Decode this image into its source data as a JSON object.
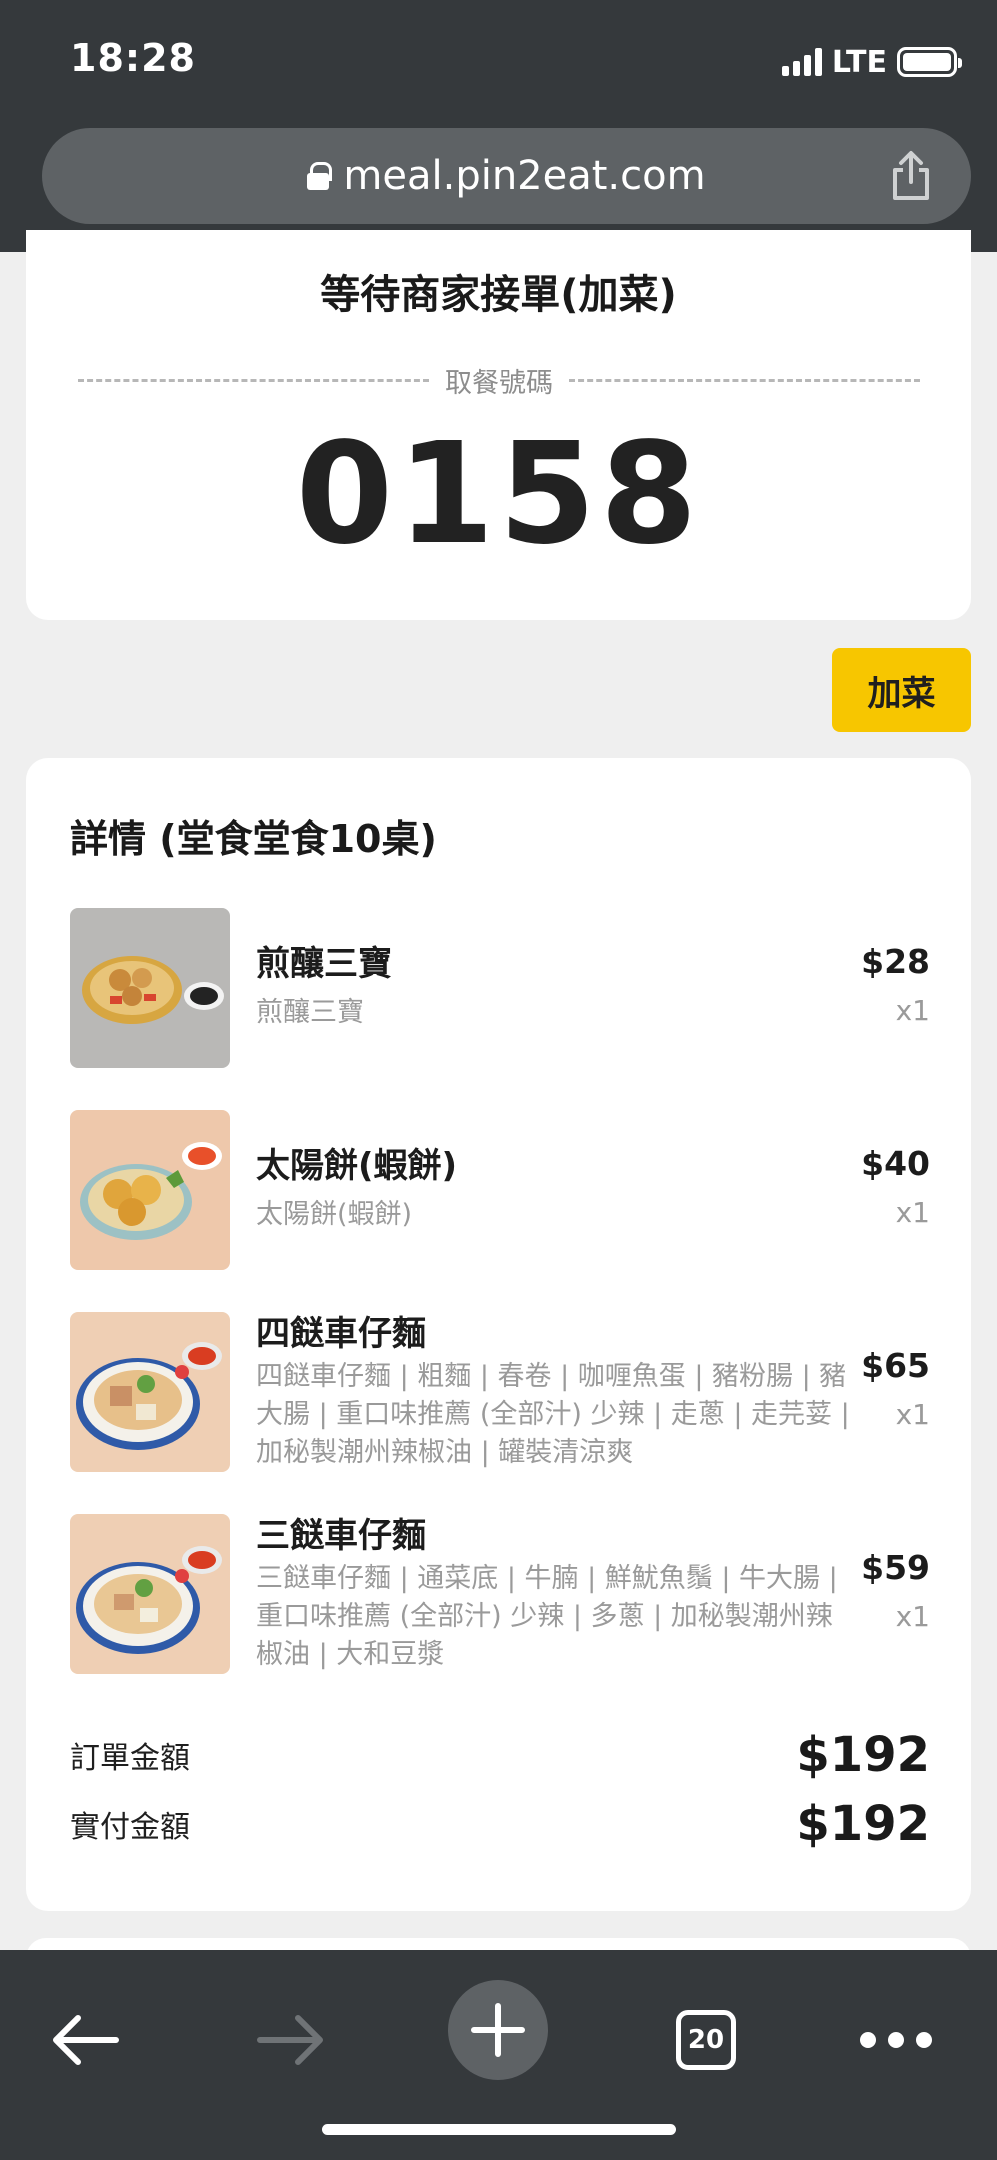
{
  "status_bar": {
    "time": "18:28",
    "network": "LTE"
  },
  "browser": {
    "url": "meal.pin2eat.com",
    "tab_count": "20",
    "icons": {
      "lock": "lock-icon",
      "share": "share-icon",
      "back": "arrow-left-icon",
      "forward": "arrow-right-icon",
      "new_tab": "plus-icon",
      "tabs": "tabs-icon",
      "more": "more-icon"
    }
  },
  "order_status": {
    "title": "等待商家接單(加菜)",
    "pickup_label": "取餐號碼",
    "pickup_number": "0158"
  },
  "add_dish_button": "加菜",
  "details": {
    "heading": "詳情 (堂食堂食10桌)",
    "items": [
      {
        "name": "煎釀三寶",
        "description": "煎釀三寶",
        "price": "$28",
        "quantity": "x1"
      },
      {
        "name": "太陽餅(蝦餅)",
        "description": "太陽餅(蝦餅)",
        "price": "$40",
        "quantity": "x1"
      },
      {
        "name": "四餸車仔麵",
        "description": "四餸車仔麵 | 粗麵 | 春卷 | 咖喱魚蛋 | 豬粉腸 | 豬大腸 | 重口味推薦 (全部汁) 少辣 | 走蔥 | 走芫荽 | 加秘製潮州辣椒油 | 罐裝清涼爽",
        "price": "$65",
        "quantity": "x1"
      },
      {
        "name": "三餸車仔麵",
        "description": "三餸車仔麵 | 通菜底 | 牛腩 | 鮮魷魚鬚 | 牛大腸 | 重口味推薦 (全部汁) 少辣 | 多蔥 | 加秘製潮州辣椒油 | 大和豆漿",
        "price": "$59",
        "quantity": "x1"
      }
    ],
    "order_total_label": "訂單金額",
    "order_total": "$192",
    "paid_total_label": "實付金額",
    "paid_total": "$192"
  },
  "colors": {
    "chrome": "#35393c",
    "accent": "#f7c600",
    "background": "#efefef"
  }
}
